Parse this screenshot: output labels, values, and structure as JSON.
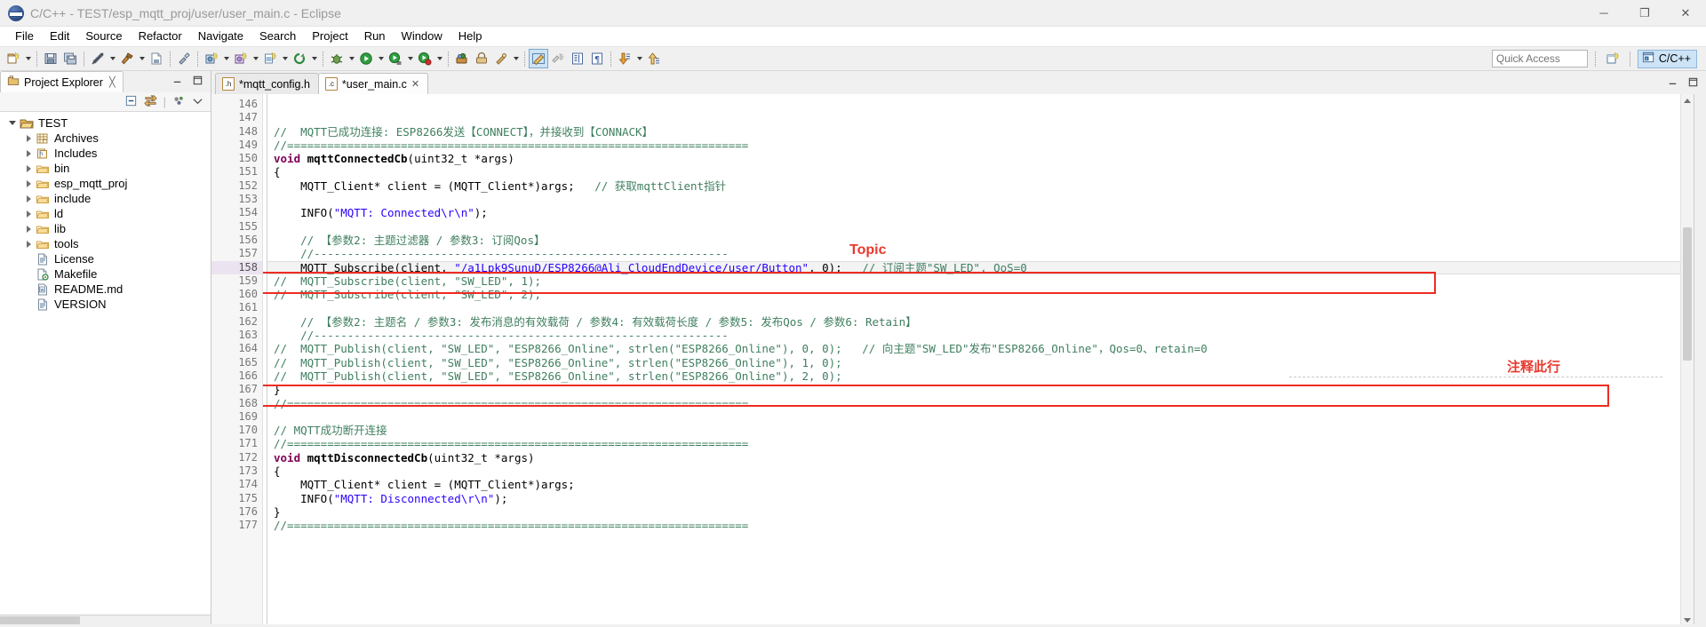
{
  "window": {
    "title": "C/C++ - TEST/esp_mqtt_proj/user/user_main.c - Eclipse",
    "app_icon": "eclipse-icon",
    "minimize": "─",
    "maximize": "❐",
    "close": "✕"
  },
  "menubar": {
    "items": [
      {
        "label": "File"
      },
      {
        "label": "Edit"
      },
      {
        "label": "Source"
      },
      {
        "label": "Refactor"
      },
      {
        "label": "Navigate"
      },
      {
        "label": "Search"
      },
      {
        "label": "Project"
      },
      {
        "label": "Run"
      },
      {
        "label": "Window"
      },
      {
        "label": "Help"
      }
    ]
  },
  "toolbar": {
    "quick_access_placeholder": "Quick Access",
    "open_perspective_icon": "open-perspective-icon",
    "perspective_label": "C/C++",
    "perspective_icon": "cpp-perspective-icon",
    "buttons": [
      "new-c-project-icon",
      "save-icon",
      "save-all-icon",
      "disable-build-icon",
      "build-hammer-icon",
      "build-config-icon",
      "new-element-icon",
      "new-class-icon",
      "new-header-icon",
      "new-source-folder-icon",
      "refresh-icon",
      "debug-icon",
      "run-icon",
      "run-config-icon",
      "run-last-icon",
      "external-tools-icon",
      "open-terminal-icon",
      "skip-breakpoints-icon",
      "toggle-markers-icon",
      "toggle-annotation-icon",
      "show-whitespace-icon",
      "show-print-margin-icon",
      "next-annotation-icon",
      "previous-annotation-icon"
    ]
  },
  "explorer": {
    "tab_label": "Project Explorer",
    "tab_icon": "project-explorer-icon",
    "close_icon": "close-icon",
    "minimize_icon": "minimize-view-icon",
    "maximize_icon": "maximize-view-icon",
    "tools": [
      "collapse-all-icon",
      "link-with-editor-icon",
      "view-filters-icon",
      "view-menu-icon"
    ],
    "tree": [
      {
        "label": "TEST",
        "indent": 0,
        "twisty": "expanded",
        "icon": "project-folder-icon"
      },
      {
        "label": "Archives",
        "indent": 1,
        "twisty": "collapsed",
        "icon": "archives-icon"
      },
      {
        "label": "Includes",
        "indent": 1,
        "twisty": "collapsed",
        "icon": "includes-icon"
      },
      {
        "label": "bin",
        "indent": 1,
        "twisty": "collapsed",
        "icon": "folder-icon"
      },
      {
        "label": "esp_mqtt_proj",
        "indent": 1,
        "twisty": "collapsed",
        "icon": "folder-icon"
      },
      {
        "label": "include",
        "indent": 1,
        "twisty": "collapsed",
        "icon": "folder-icon"
      },
      {
        "label": "ld",
        "indent": 1,
        "twisty": "collapsed",
        "icon": "folder-icon"
      },
      {
        "label": "lib",
        "indent": 1,
        "twisty": "collapsed",
        "icon": "folder-icon"
      },
      {
        "label": "tools",
        "indent": 1,
        "twisty": "collapsed",
        "icon": "folder-icon"
      },
      {
        "label": "License",
        "indent": 1,
        "twisty": "none",
        "icon": "file-icon"
      },
      {
        "label": "Makefile",
        "indent": 1,
        "twisty": "none",
        "icon": "makefile-icon"
      },
      {
        "label": "README.md",
        "indent": 1,
        "twisty": "none",
        "icon": "markdown-file-icon"
      },
      {
        "label": "VERSION",
        "indent": 1,
        "twisty": "none",
        "icon": "file-icon"
      }
    ]
  },
  "editor": {
    "tabs": [
      {
        "label": "*mqtt_config.h",
        "badge": ".h",
        "active": false,
        "closable": false
      },
      {
        "label": "*user_main.c",
        "badge": ".c",
        "active": true,
        "closable": true
      }
    ],
    "tab_close_icon": "close-icon",
    "minimize_icon": "minimize-view-icon",
    "maximize_icon": "maximize-view-icon",
    "first_line_number": 146,
    "highlighted_line": 158,
    "lines": [
      {
        "num": 146,
        "fold": false,
        "tokens": []
      },
      {
        "num": 147,
        "fold": false,
        "tokens": []
      },
      {
        "num": 148,
        "fold": true,
        "tokens": [
          {
            "t": "//  MQTT已成功连接: ESP8266发送【CONNECT】，并接收到【CONNACK】",
            "c": "c"
          }
        ]
      },
      {
        "num": 149,
        "fold": false,
        "tokens": [
          {
            "t": "//=====================================================================",
            "c": "c"
          }
        ]
      },
      {
        "num": 150,
        "fold": true,
        "tokens": [
          {
            "t": "void",
            "c": "k"
          },
          {
            "t": " ",
            "c": "n"
          },
          {
            "t": "mqttConnectedCb",
            "c": "fn"
          },
          {
            "t": "(",
            "c": "n"
          },
          {
            "t": "uint32_t",
            "c": "ty"
          },
          {
            "t": " *args)",
            "c": "n"
          }
        ]
      },
      {
        "num": 151,
        "fold": false,
        "tokens": [
          {
            "t": "{",
            "c": "n"
          }
        ]
      },
      {
        "num": 152,
        "fold": false,
        "tokens": [
          {
            "t": "    MQTT_Client* client = (MQTT_Client*)args;   ",
            "c": "n"
          },
          {
            "t": "// 获取mqttClient指针",
            "c": "c"
          }
        ]
      },
      {
        "num": 153,
        "fold": false,
        "tokens": []
      },
      {
        "num": 154,
        "fold": false,
        "tokens": [
          {
            "t": "    INFO(",
            "c": "n"
          },
          {
            "t": "\"MQTT: Connected\\r\\n\"",
            "c": "s"
          },
          {
            "t": ");",
            "c": "n"
          }
        ]
      },
      {
        "num": 155,
        "fold": false,
        "tokens": []
      },
      {
        "num": 156,
        "fold": false,
        "tokens": [
          {
            "t": "    // 【参数2: 主题过滤器 / 参数3: 订阅Qos】",
            "c": "c"
          }
        ]
      },
      {
        "num": 157,
        "fold": false,
        "tokens": [
          {
            "t": "    //--------------------------------------------------------------",
            "c": "c"
          }
        ]
      },
      {
        "num": 158,
        "fold": false,
        "tokens": [
          {
            "t": "    MQTT_Subscribe(client, ",
            "c": "n"
          },
          {
            "t": "\"/a1Lpk9SunuD/ESP8266@Ali_CloudEndDevice/user/Button\"",
            "c": "s"
          },
          {
            "t": ", 0);   ",
            "c": "n"
          },
          {
            "t": "// 订阅主题\"SW_LED\", QoS=0",
            "c": "c"
          }
        ]
      },
      {
        "num": 159,
        "fold": true,
        "tokens": [
          {
            "t": "//  MQTT_Subscribe(client, \"SW_LED\", 1);",
            "c": "c"
          }
        ]
      },
      {
        "num": 160,
        "fold": false,
        "tokens": [
          {
            "t": "//  MQTT_Subscribe(client, \"SW_LED\", 2);",
            "c": "c"
          }
        ]
      },
      {
        "num": 161,
        "fold": false,
        "tokens": []
      },
      {
        "num": 162,
        "fold": false,
        "tokens": [
          {
            "t": "    // 【参数2: 主题名 / 参数3: 发布消息的有效载荷 / 参数4: 有效载荷长度 / 参数5: 发布Qos / 参数6: Retain】",
            "c": "c"
          }
        ]
      },
      {
        "num": 163,
        "fold": false,
        "tokens": [
          {
            "t": "    //--------------------------------------------------------------",
            "c": "c"
          }
        ]
      },
      {
        "num": 164,
        "fold": true,
        "tokens": [
          {
            "t": "//  MQTT_Publish(client, \"SW_LED\", \"ESP8266_Online\", strlen(\"ESP8266_Online\"), 0, 0);   // 向主题\"SW_LED\"发布\"ESP8266_Online\"，Qos=0、retain=0",
            "c": "c"
          }
        ]
      },
      {
        "num": 165,
        "fold": false,
        "tokens": [
          {
            "t": "//  MQTT_Publish(client, \"SW_LED\", \"ESP8266_Online\", strlen(\"ESP8266_Online\"), 1, 0);",
            "c": "c"
          }
        ]
      },
      {
        "num": 166,
        "fold": false,
        "tokens": [
          {
            "t": "//  MQTT_Publish(client, \"SW_LED\", \"ESP8266_Online\", strlen(\"ESP8266_Online\"), 2, 0);",
            "c": "c"
          }
        ]
      },
      {
        "num": 167,
        "fold": false,
        "tokens": [
          {
            "t": "}",
            "c": "n"
          }
        ]
      },
      {
        "num": 168,
        "fold": false,
        "tokens": [
          {
            "t": "//=====================================================================",
            "c": "c"
          }
        ]
      },
      {
        "num": 169,
        "fold": false,
        "tokens": []
      },
      {
        "num": 170,
        "fold": true,
        "tokens": [
          {
            "t": "// MQTT成功断开连接",
            "c": "c"
          }
        ]
      },
      {
        "num": 171,
        "fold": false,
        "tokens": [
          {
            "t": "//=====================================================================",
            "c": "c"
          }
        ]
      },
      {
        "num": 172,
        "fold": true,
        "tokens": [
          {
            "t": "void",
            "c": "k"
          },
          {
            "t": " ",
            "c": "n"
          },
          {
            "t": "mqttDisconnectedCb",
            "c": "fn"
          },
          {
            "t": "(",
            "c": "n"
          },
          {
            "t": "uint32_t",
            "c": "ty"
          },
          {
            "t": " *args)",
            "c": "n"
          }
        ]
      },
      {
        "num": 173,
        "fold": false,
        "tokens": [
          {
            "t": "{",
            "c": "n"
          }
        ]
      },
      {
        "num": 174,
        "fold": false,
        "tokens": [
          {
            "t": "    MQTT_Client* client = (MQTT_Client*)args;",
            "c": "n"
          }
        ]
      },
      {
        "num": 175,
        "fold": false,
        "tokens": [
          {
            "t": "    INFO(",
            "c": "n"
          },
          {
            "t": "\"MQTT: Disconnected\\r\\n\"",
            "c": "s"
          },
          {
            "t": ");",
            "c": "n"
          }
        ]
      },
      {
        "num": 176,
        "fold": false,
        "tokens": [
          {
            "t": "}",
            "c": "n"
          }
        ]
      },
      {
        "num": 177,
        "fold": false,
        "tokens": [
          {
            "t": "//=====================================================================",
            "c": "c"
          }
        ]
      }
    ]
  },
  "annotations": {
    "accent_color": "#ee2b21",
    "labels": [
      {
        "text": "Topic",
        "name": "annotation-topic-label"
      },
      {
        "text": "注释此行",
        "name": "annotation-comment-this-line-label"
      }
    ]
  }
}
